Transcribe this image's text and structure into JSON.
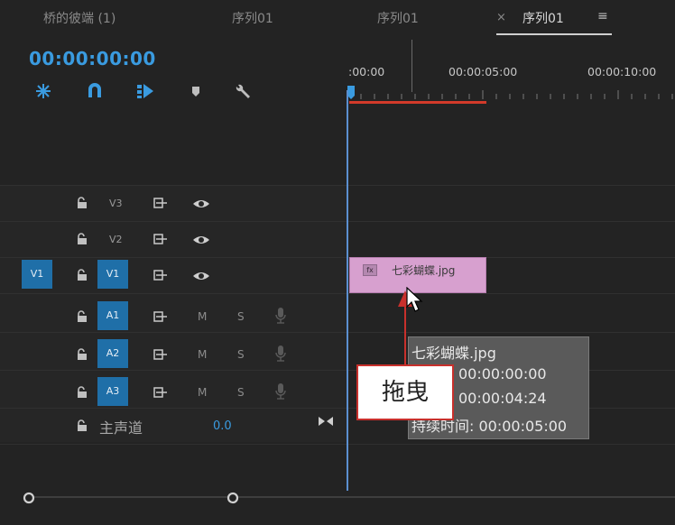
{
  "tabs": [
    {
      "label": "桥的彼端 (1)"
    },
    {
      "label": "序列01"
    },
    {
      "label": "序列01"
    },
    {
      "label": "序列01"
    }
  ],
  "tab_close": "×",
  "tab_menu": "≡",
  "timecode": "00:00:00:00",
  "ruler": {
    "labels": [
      ":00:00",
      "00:00:05:00",
      "00:00:10:00"
    ]
  },
  "video_tracks": [
    {
      "target": "",
      "name": "V3"
    },
    {
      "target": "",
      "name": "V2"
    },
    {
      "target": "V1",
      "name": "V1"
    }
  ],
  "audio_tracks": [
    {
      "name": "A1",
      "m": "M",
      "s": "S"
    },
    {
      "name": "A2",
      "m": "M",
      "s": "S"
    },
    {
      "name": "A3",
      "m": "M",
      "s": "S"
    }
  ],
  "master": {
    "label": "主声道",
    "value": "0.0"
  },
  "clip": {
    "fx": "fx",
    "name": "七彩蝴蝶.jpg"
  },
  "tooltip": {
    "title": "七彩蝴蝶.jpg",
    "start": "00:00:00:00",
    "end": "00:00:04:24",
    "duration": "持续时间: 00:00:05:00"
  },
  "callout": "拖曳",
  "colors": {
    "accent": "#3a9be0",
    "track_button": "#1f6fa8",
    "clip": "#d7a0cf",
    "annotation_red": "#c8302c"
  }
}
